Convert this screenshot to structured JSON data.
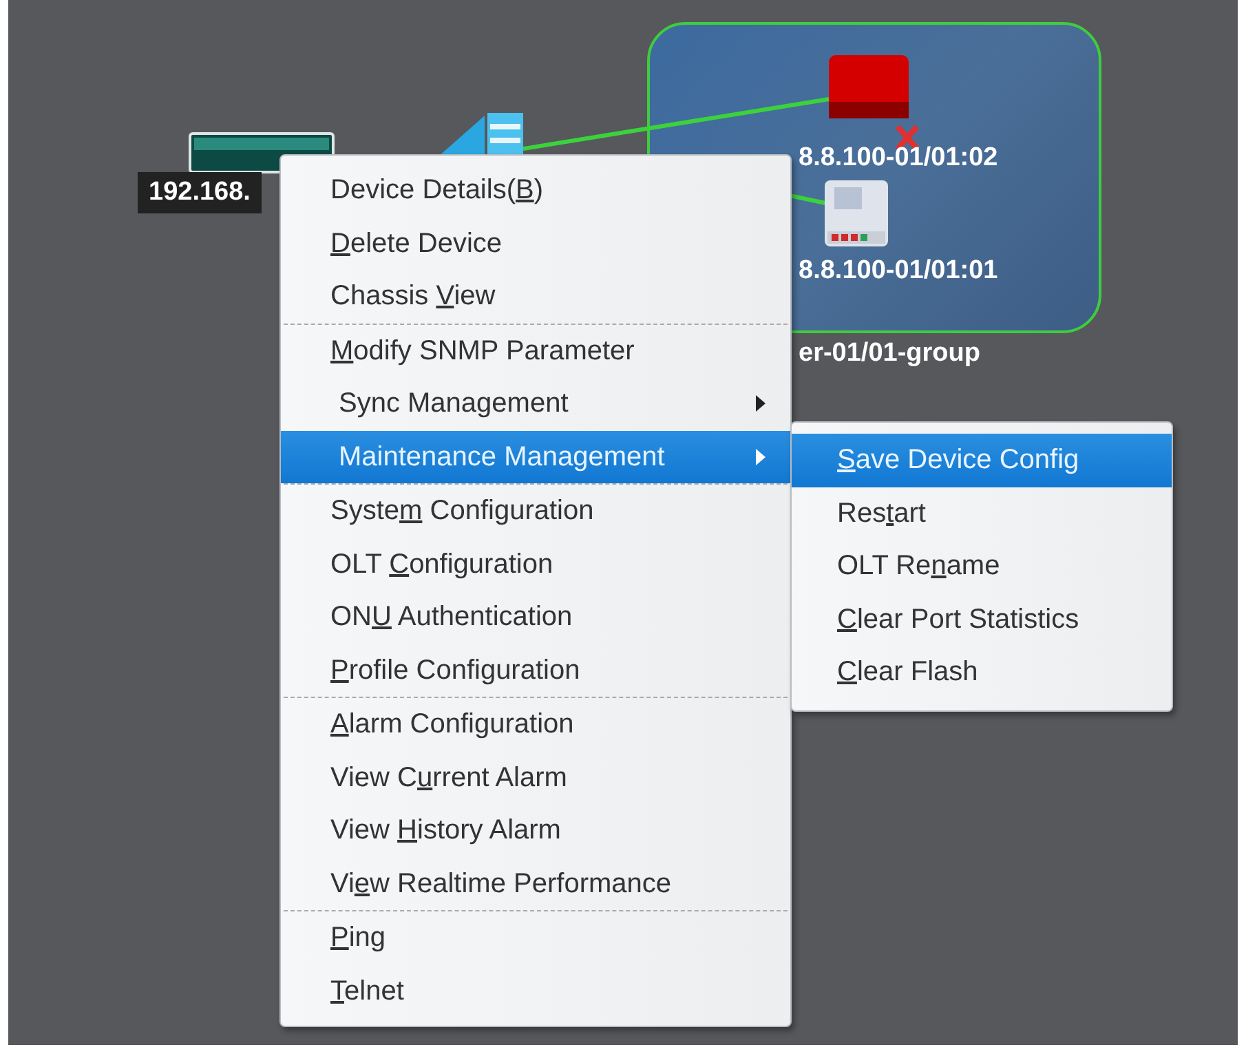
{
  "topology": {
    "olt_label": "192.168.",
    "onu_labels": [
      "8.8.100-01/01:02",
      "8.8.100-01/01:01"
    ],
    "group_label": "er-01/01-group"
  },
  "context_menu": {
    "groups": [
      [
        {
          "kind": "item",
          "before": "Device Details(",
          "mnemonic": "B",
          "after": ")",
          "selected": false
        },
        {
          "kind": "item",
          "mnemonic": "D",
          "after": "elete Device",
          "selected": false
        },
        {
          "kind": "item",
          "before": "Chassis ",
          "mnemonic": "V",
          "after": "iew",
          "selected": false
        }
      ],
      [
        {
          "kind": "item",
          "mnemonic": "M",
          "after": "odify SNMP Parameter",
          "selected": false
        },
        {
          "kind": "submenu",
          "before": "Sync Management",
          "selected": false
        },
        {
          "kind": "submenu",
          "before": "Maintenance Management",
          "selected": true
        }
      ],
      [
        {
          "kind": "item",
          "before": "Syste",
          "mnemonic": "m",
          "after": " Configuration",
          "selected": false
        },
        {
          "kind": "item",
          "before": "OLT ",
          "mnemonic": "C",
          "after": "onfiguration",
          "selected": false
        },
        {
          "kind": "item",
          "before": "ON",
          "mnemonic": "U",
          "after": " Authentication",
          "selected": false
        },
        {
          "kind": "item",
          "mnemonic": "P",
          "after": "rofile Configuration",
          "selected": false
        }
      ],
      [
        {
          "kind": "item",
          "mnemonic": "A",
          "after": "larm Configuration",
          "selected": false
        },
        {
          "kind": "item",
          "before": "View C",
          "mnemonic": "u",
          "after": "rrent Alarm",
          "selected": false
        },
        {
          "kind": "item",
          "before": "View ",
          "mnemonic": "H",
          "after": "istory Alarm",
          "selected": false
        },
        {
          "kind": "item",
          "before": "Vi",
          "mnemonic": "e",
          "after": "w Realtime Performance",
          "selected": false
        }
      ],
      [
        {
          "kind": "item",
          "mnemonic": "P",
          "after": "ing",
          "selected": false
        },
        {
          "kind": "item",
          "mnemonic": "T",
          "after": "elnet",
          "selected": false
        }
      ]
    ]
  },
  "submenu": {
    "items": [
      {
        "mnemonic": "S",
        "after": "ave Device Config",
        "selected": true
      },
      {
        "before": "Res",
        "mnemonic": "t",
        "after": "art",
        "selected": false
      },
      {
        "before": "OLT Re",
        "mnemonic": "n",
        "after": "ame",
        "selected": false
      },
      {
        "mnemonic": "C",
        "after": "lear Port Statistics",
        "selected": false
      },
      {
        "mnemonic": "C",
        "after": "lear Flash",
        "selected": false
      }
    ]
  }
}
